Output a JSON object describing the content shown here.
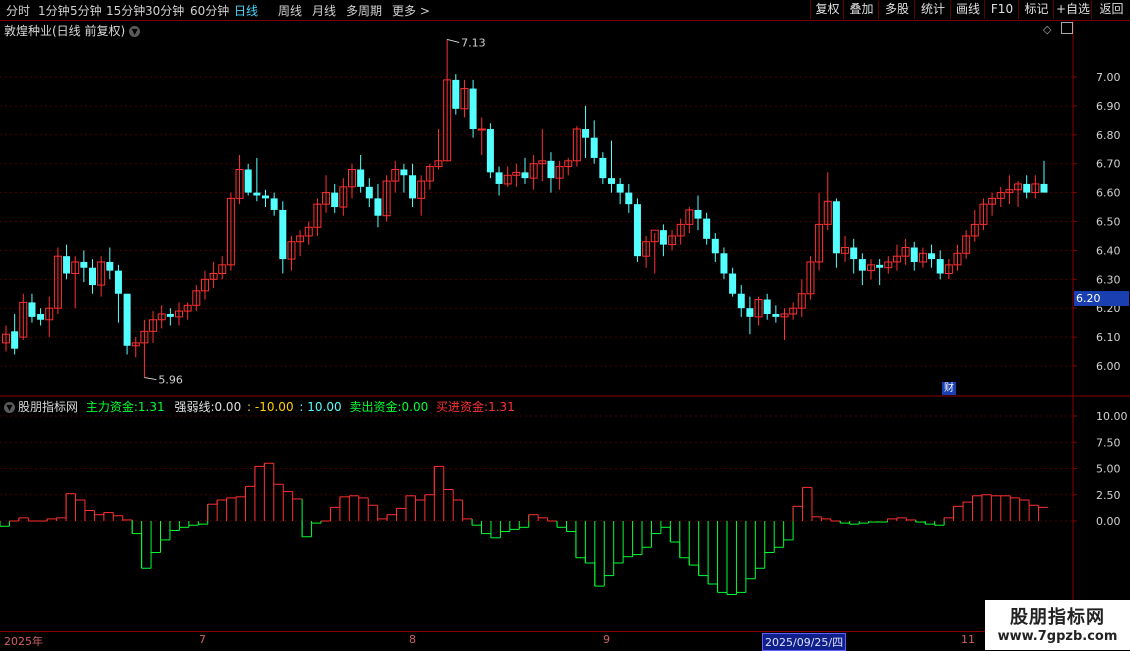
{
  "toolbar": {
    "periods": [
      "分时",
      "1分钟",
      "5分钟",
      "15分钟",
      "30分钟",
      "60分钟",
      "日线",
      "周线",
      "月线",
      "多周期",
      "更多 >"
    ],
    "active_period": "日线",
    "right_buttons": [
      "复权",
      "叠加",
      "多股",
      "统计",
      "画线",
      "F10",
      "标记",
      "+自选",
      "返回"
    ]
  },
  "stock": {
    "title": "敦煌种业(日线 前复权)"
  },
  "price_axis": {
    "ticks": [
      "7.00",
      "6.90",
      "6.80",
      "6.70",
      "6.60",
      "6.50",
      "6.40",
      "6.30",
      "6.20",
      "6.10",
      "6.00"
    ],
    "current_price": "6.20"
  },
  "annotations": {
    "high_label": "7.13",
    "low_label": "5.96",
    "cai_label": "财"
  },
  "indicator": {
    "name": "股朋指标网",
    "main_fund_label": "主力资金:",
    "main_fund_value": "1.31",
    "strength_label": "强弱线:",
    "strength_value": "0.00",
    "minus10": ": -10.00",
    "plus10": ": 10.00",
    "sell_label": "卖出资金:",
    "sell_value": "0.00",
    "buy_label": "买进资金:",
    "buy_value": "1.31",
    "axis_ticks": [
      "10.00",
      "7.50",
      "5.00",
      "2.50",
      "0.00"
    ]
  },
  "time_axis": {
    "labels": [
      "2025年",
      "7",
      "8",
      "9",
      "11"
    ],
    "selected_date": "2025/09/25/四"
  },
  "watermark": {
    "line1": "股朋指标网",
    "line2": "www.7gpzb.com"
  },
  "colors": {
    "up": "#ff3030",
    "down": "#54ffff",
    "green": "#00ff30",
    "axis": "#8a0000",
    "active": "#4ad7ff"
  },
  "chart_data": {
    "type": "candlestick",
    "y_range": [
      5.95,
      7.15
    ],
    "candles": [
      [
        6.08,
        6.14,
        6.05,
        6.11
      ],
      [
        6.12,
        6.18,
        6.04,
        6.06
      ],
      [
        6.1,
        6.25,
        6.09,
        6.22
      ],
      [
        6.22,
        6.25,
        6.15,
        6.17
      ],
      [
        6.18,
        6.2,
        6.14,
        6.16
      ],
      [
        6.16,
        6.24,
        6.1,
        6.2
      ],
      [
        6.2,
        6.41,
        6.18,
        6.38
      ],
      [
        6.38,
        6.42,
        6.3,
        6.32
      ],
      [
        6.32,
        6.38,
        6.2,
        6.36
      ],
      [
        6.36,
        6.4,
        6.29,
        6.34
      ],
      [
        6.34,
        6.37,
        6.25,
        6.28
      ],
      [
        6.28,
        6.38,
        6.24,
        6.36
      ],
      [
        6.36,
        6.41,
        6.3,
        6.33
      ],
      [
        6.33,
        6.35,
        6.15,
        6.25
      ],
      [
        6.25,
        6.25,
        6.04,
        6.07
      ],
      [
        6.07,
        6.1,
        6.03,
        6.08
      ],
      [
        6.08,
        6.16,
        5.96,
        6.12
      ],
      [
        6.12,
        6.19,
        6.08,
        6.16
      ],
      [
        6.16,
        6.21,
        6.13,
        6.18
      ],
      [
        6.18,
        6.2,
        6.14,
        6.17
      ],
      [
        6.17,
        6.22,
        6.14,
        6.19
      ],
      [
        6.19,
        6.22,
        6.16,
        6.21
      ],
      [
        6.21,
        6.28,
        6.19,
        6.26
      ],
      [
        6.26,
        6.33,
        6.23,
        6.3
      ],
      [
        6.3,
        6.36,
        6.27,
        6.32
      ],
      [
        6.32,
        6.38,
        6.3,
        6.35
      ],
      [
        6.35,
        6.6,
        6.33,
        6.58
      ],
      [
        6.58,
        6.73,
        6.56,
        6.68
      ],
      [
        6.68,
        6.7,
        6.59,
        6.6
      ],
      [
        6.6,
        6.72,
        6.57,
        6.59
      ],
      [
        6.59,
        6.61,
        6.55,
        6.58
      ],
      [
        6.58,
        6.6,
        6.52,
        6.54
      ],
      [
        6.54,
        6.57,
        6.32,
        6.37
      ],
      [
        6.37,
        6.45,
        6.33,
        6.43
      ],
      [
        6.43,
        6.47,
        6.38,
        6.45
      ],
      [
        6.45,
        6.5,
        6.42,
        6.48
      ],
      [
        6.48,
        6.58,
        6.45,
        6.56
      ],
      [
        6.56,
        6.66,
        6.53,
        6.6
      ],
      [
        6.6,
        6.63,
        6.53,
        6.55
      ],
      [
        6.55,
        6.65,
        6.52,
        6.62
      ],
      [
        6.62,
        6.7,
        6.58,
        6.68
      ],
      [
        6.68,
        6.73,
        6.6,
        6.62
      ],
      [
        6.62,
        6.65,
        6.55,
        6.58
      ],
      [
        6.58,
        6.63,
        6.48,
        6.52
      ],
      [
        6.52,
        6.66,
        6.5,
        6.64
      ],
      [
        6.64,
        6.71,
        6.6,
        6.68
      ],
      [
        6.68,
        6.7,
        6.6,
        6.66
      ],
      [
        6.66,
        6.7,
        6.55,
        6.58
      ],
      [
        6.58,
        6.66,
        6.52,
        6.64
      ],
      [
        6.64,
        6.7,
        6.61,
        6.69
      ],
      [
        6.69,
        6.82,
        6.68,
        6.71
      ],
      [
        6.71,
        7.13,
        6.71,
        6.99
      ],
      [
        6.99,
        7.01,
        6.87,
        6.89
      ],
      [
        6.89,
        6.99,
        6.86,
        6.96
      ],
      [
        6.96,
        6.99,
        6.79,
        6.82
      ],
      [
        6.82,
        6.86,
        6.73,
        6.82
      ],
      [
        6.82,
        6.84,
        6.65,
        6.67
      ],
      [
        6.67,
        6.69,
        6.59,
        6.63
      ],
      [
        6.63,
        6.69,
        6.62,
        6.66
      ],
      [
        6.66,
        6.7,
        6.62,
        6.67
      ],
      [
        6.67,
        6.72,
        6.63,
        6.65
      ],
      [
        6.65,
        6.73,
        6.61,
        6.7
      ],
      [
        6.7,
        6.82,
        6.64,
        6.71
      ],
      [
        6.71,
        6.74,
        6.6,
        6.65
      ],
      [
        6.65,
        6.71,
        6.61,
        6.69
      ],
      [
        6.69,
        6.72,
        6.66,
        6.71
      ],
      [
        6.71,
        6.83,
        6.69,
        6.82
      ],
      [
        6.82,
        6.9,
        6.72,
        6.79
      ],
      [
        6.79,
        6.85,
        6.7,
        6.72
      ],
      [
        6.72,
        6.74,
        6.63,
        6.65
      ],
      [
        6.65,
        6.78,
        6.6,
        6.63
      ],
      [
        6.63,
        6.65,
        6.56,
        6.6
      ],
      [
        6.6,
        6.63,
        6.53,
        6.56
      ],
      [
        6.56,
        6.58,
        6.36,
        6.38
      ],
      [
        6.38,
        6.45,
        6.34,
        6.43
      ],
      [
        6.43,
        6.46,
        6.32,
        6.47
      ],
      [
        6.47,
        6.49,
        6.38,
        6.42
      ],
      [
        6.42,
        6.47,
        6.4,
        6.45
      ],
      [
        6.45,
        6.51,
        6.42,
        6.49
      ],
      [
        6.49,
        6.55,
        6.46,
        6.54
      ],
      [
        6.54,
        6.59,
        6.47,
        6.51
      ],
      [
        6.51,
        6.53,
        6.42,
        6.44
      ],
      [
        6.44,
        6.46,
        6.36,
        6.39
      ],
      [
        6.39,
        6.41,
        6.3,
        6.32
      ],
      [
        6.32,
        6.34,
        6.24,
        6.25
      ],
      [
        6.25,
        6.28,
        6.17,
        6.2
      ],
      [
        6.2,
        6.24,
        6.11,
        6.17
      ],
      [
        6.17,
        6.24,
        6.14,
        6.23
      ],
      [
        6.23,
        6.25,
        6.16,
        6.18
      ],
      [
        6.18,
        6.21,
        6.15,
        6.17
      ],
      [
        6.17,
        6.2,
        6.09,
        6.18
      ],
      [
        6.18,
        6.22,
        6.16,
        6.2
      ],
      [
        6.2,
        6.3,
        6.17,
        6.25
      ],
      [
        6.25,
        6.38,
        6.23,
        6.36
      ],
      [
        6.36,
        6.6,
        6.33,
        6.49
      ],
      [
        6.49,
        6.67,
        6.47,
        6.57
      ],
      [
        6.57,
        6.58,
        6.34,
        6.39
      ],
      [
        6.39,
        6.45,
        6.36,
        6.41
      ],
      [
        6.41,
        6.44,
        6.32,
        6.37
      ],
      [
        6.37,
        6.39,
        6.28,
        6.33
      ],
      [
        6.33,
        6.37,
        6.3,
        6.35
      ],
      [
        6.35,
        6.37,
        6.28,
        6.34
      ],
      [
        6.34,
        6.38,
        6.32,
        6.36
      ],
      [
        6.36,
        6.42,
        6.33,
        6.38
      ],
      [
        6.38,
        6.44,
        6.35,
        6.41
      ],
      [
        6.41,
        6.43,
        6.33,
        6.36
      ],
      [
        6.36,
        6.41,
        6.34,
        6.39
      ],
      [
        6.39,
        6.42,
        6.34,
        6.37
      ],
      [
        6.37,
        6.4,
        6.3,
        6.32
      ],
      [
        6.32,
        6.37,
        6.3,
        6.35
      ],
      [
        6.35,
        6.42,
        6.33,
        6.39
      ],
      [
        6.39,
        6.47,
        6.37,
        6.45
      ],
      [
        6.45,
        6.54,
        6.43,
        6.49
      ],
      [
        6.49,
        6.58,
        6.47,
        6.56
      ],
      [
        6.56,
        6.6,
        6.52,
        6.58
      ],
      [
        6.58,
        6.62,
        6.55,
        6.6
      ],
      [
        6.6,
        6.66,
        6.56,
        6.61
      ],
      [
        6.61,
        6.64,
        6.55,
        6.63
      ],
      [
        6.63,
        6.66,
        6.58,
        6.6
      ],
      [
        6.6,
        6.66,
        6.58,
        6.63
      ],
      [
        6.63,
        6.71,
        6.6,
        6.6
      ]
    ],
    "indicator_values": [
      -0.5,
      0,
      0.3,
      0,
      0,
      0.2,
      0.3,
      2.6,
      2.0,
      1.0,
      0.6,
      0.8,
      0.5,
      0.1,
      -1.2,
      -4.5,
      -3.0,
      -1.8,
      -0.9,
      -0.6,
      -0.4,
      -0.3,
      1.6,
      2.0,
      2.2,
      2.3,
      3.3,
      5.2,
      5.5,
      3.5,
      2.8,
      2.1,
      -1.5,
      -0.2,
      0,
      1.3,
      2.3,
      2.4,
      2.2,
      1.5,
      0.2,
      0.6,
      1.2,
      2.4,
      2.0,
      2.5,
      5.2,
      3.0,
      2.0,
      0.2,
      -0.4,
      -1.2,
      -1.6,
      -1.0,
      -0.8,
      -0.6,
      0.6,
      0.3,
      0,
      -0.6,
      -1.0,
      -3.5,
      -4.0,
      -6.2,
      -5.2,
      -4.0,
      -3.4,
      -3.2,
      -2.5,
      -1.2,
      -0.6,
      -2.0,
      -3.5,
      -4.2,
      -5.2,
      -6.0,
      -6.8,
      -7.0,
      -6.8,
      -5.5,
      -4.5,
      -3.0,
      -2.5,
      -1.8,
      1.4,
      3.2,
      0.4,
      0.2,
      0,
      -0.2,
      -0.3,
      -0.2,
      -0.1,
      -0.1,
      0.2,
      0.3,
      0.1,
      -0.1,
      -0.3,
      -0.4,
      0.3,
      1.4,
      1.8,
      2.4,
      2.5,
      2.4,
      2.4,
      2.2,
      2.0,
      1.5,
      1.3
    ]
  }
}
